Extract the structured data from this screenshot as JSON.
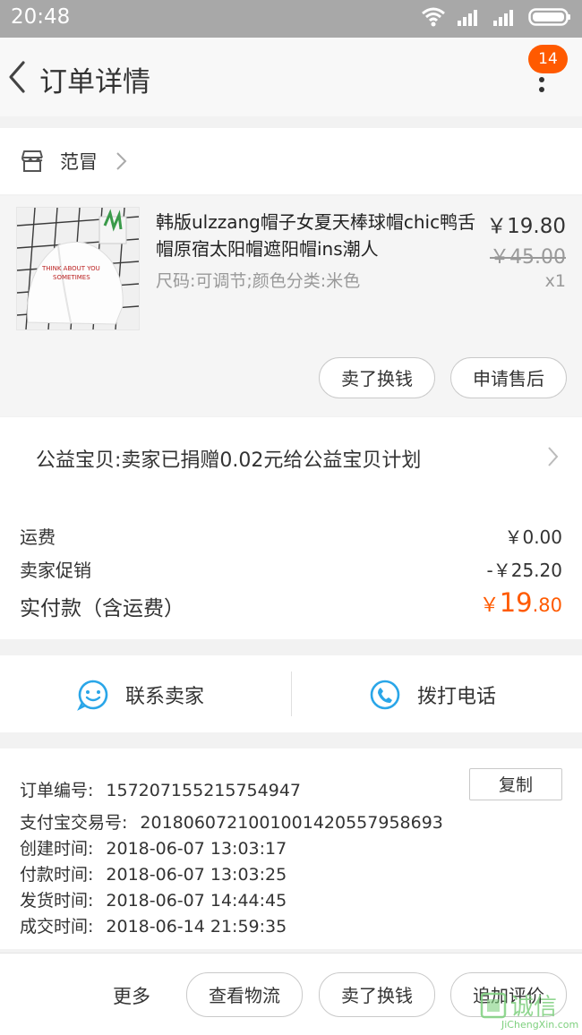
{
  "status_bar": {
    "time": "20:48"
  },
  "header": {
    "title": "订单详情",
    "back_icon": "chevron-left-icon",
    "more_icon": "more-vertical-icon",
    "badge_count": "14"
  },
  "shop": {
    "name": "范冒",
    "icon": "shop-icon"
  },
  "item": {
    "title": "韩版ulzzang帽子女夏天棒球帽chic鸭舌帽原宿太阳帽遮阳帽ins潮人",
    "spec": "尺码:可调节;颜色分类:米色",
    "price_now": "￥19.80",
    "price_original": "￥45.00",
    "quantity": "x1",
    "thumb_text_1": "THINK ABOUT YOU",
    "thumb_text_2": "SOMETIMES",
    "sell_button": "卖了换钱",
    "after_sale_button": "申请售后"
  },
  "charity": {
    "text": "公益宝贝:卖家已捐赠0.02元给公益宝贝计划"
  },
  "fees": {
    "shipping_label": "运费",
    "shipping_value": "￥0.00",
    "promo_label": "卖家促销",
    "promo_value": "-￥25.20",
    "total_label": "实付款（含运费）",
    "total_currency": "￥",
    "total_integer": "19",
    "total_decimal": ".80"
  },
  "contact": {
    "seller_label": "联系卖家",
    "phone_label": "拨打电话"
  },
  "order_info": {
    "copy_button": "复制",
    "lines": [
      {
        "label": "订单编号:",
        "value": "157207155215754947"
      },
      {
        "label": "支付宝交易号:",
        "value": "2018060721001001420557958693"
      },
      {
        "label": "创建时间:",
        "value": "2018-06-07 13:03:17"
      },
      {
        "label": "付款时间:",
        "value": "2018-06-07 13:03:25"
      },
      {
        "label": "发货时间:",
        "value": "2018-06-07 14:44:45"
      },
      {
        "label": "成交时间:",
        "value": "2018-06-14 21:59:35"
      }
    ]
  },
  "bottom": {
    "more": "更多",
    "logistics": "查看物流",
    "sell": "卖了换钱",
    "review": "追加评价"
  },
  "watermark": {
    "main": "诚信",
    "sub": "JiChengXin.com"
  },
  "colors": {
    "accent": "#ff5a00",
    "icon_blue": "#2aa6e8",
    "status_bar": "#a8a8a8"
  }
}
